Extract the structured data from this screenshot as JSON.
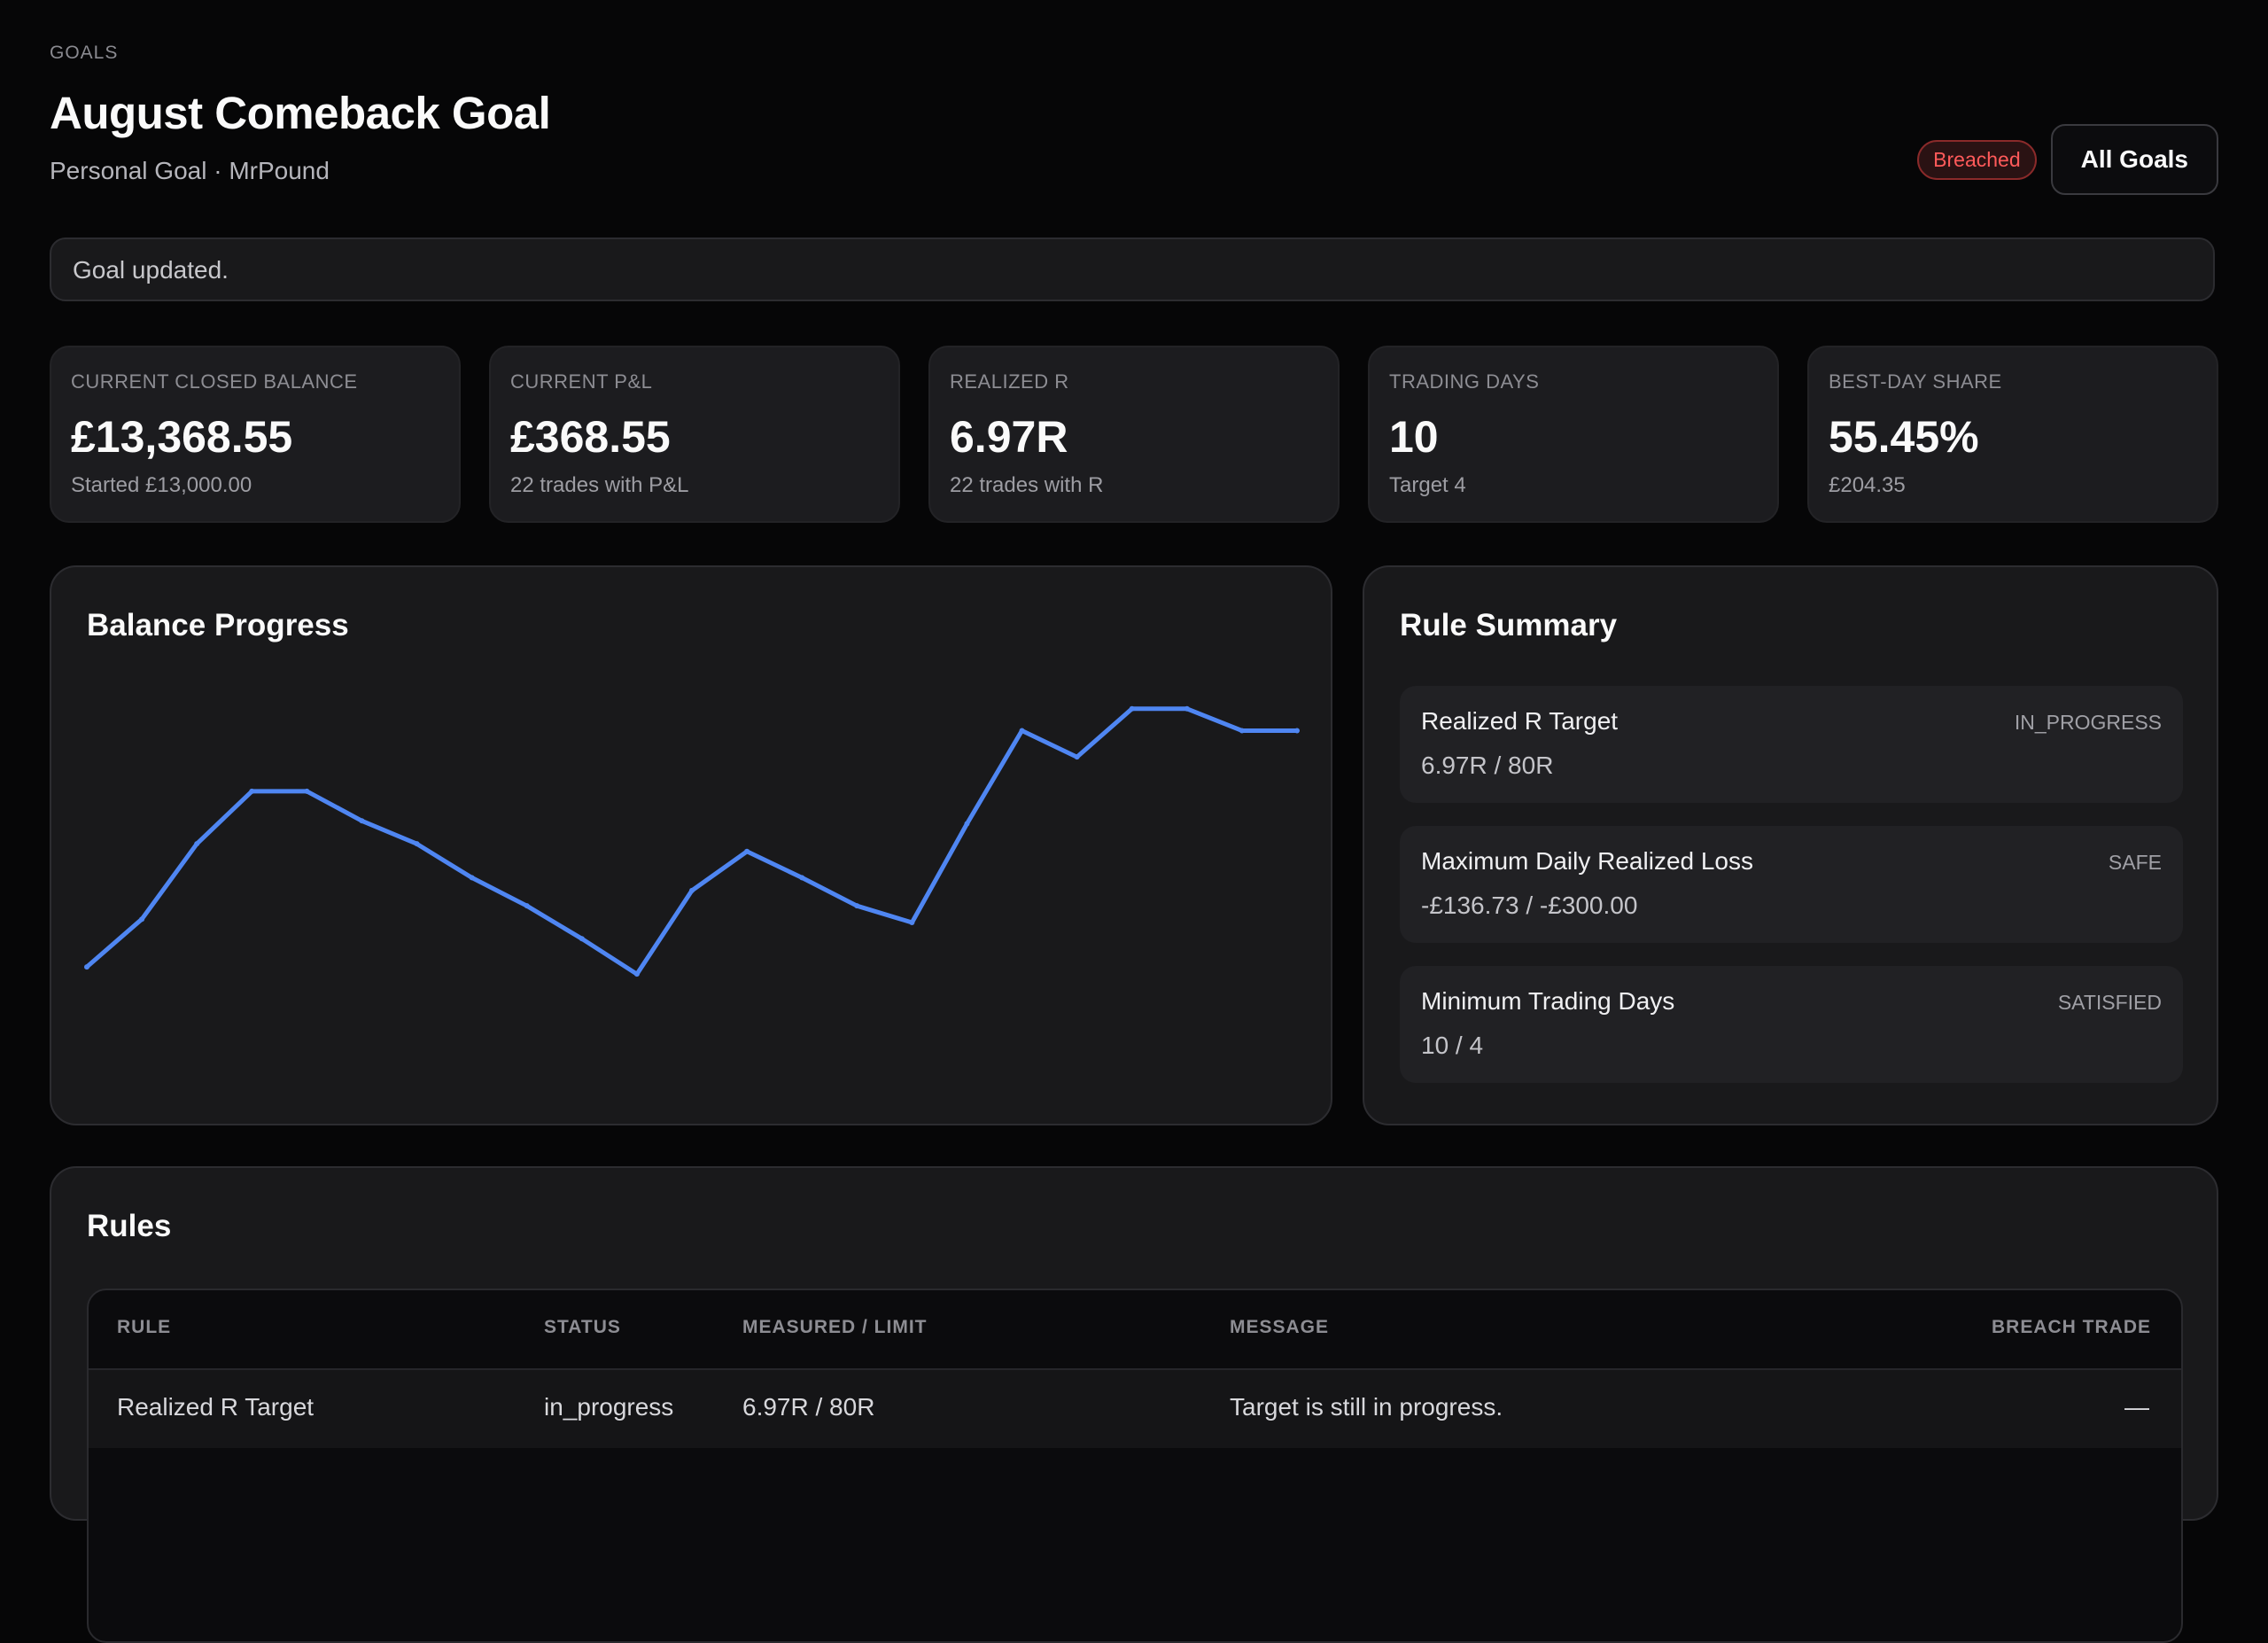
{
  "header": {
    "eyebrow": "GOALS",
    "title": "August Comeback Goal",
    "subtitle": "Personal Goal · MrPound",
    "status_badge": "Breached",
    "all_goals_label": "All Goals"
  },
  "notice": "Goal updated.",
  "stats": [
    {
      "label": "CURRENT CLOSED BALANCE",
      "value": "£13,368.55",
      "sub": "Started £13,000.00"
    },
    {
      "label": "CURRENT P&L",
      "value": "£368.55",
      "sub": "22 trades with P&L"
    },
    {
      "label": "REALIZED R",
      "value": "6.97R",
      "sub": "22 trades with R"
    },
    {
      "label": "TRADING DAYS",
      "value": "10",
      "sub": "Target 4"
    },
    {
      "label": "BEST-DAY SHARE",
      "value": "55.45%",
      "sub": "£204.35"
    }
  ],
  "balance_progress": {
    "title": "Balance Progress",
    "line_color": "#4f86f2"
  },
  "chart_data": {
    "type": "line",
    "title": "Balance Progress",
    "x": [
      1,
      2,
      3,
      4,
      5,
      6,
      7,
      8,
      9,
      10,
      11,
      12,
      13,
      14,
      15,
      16,
      17,
      18,
      19,
      20,
      21,
      22,
      23
    ],
    "values": [
      13000,
      13100,
      13258,
      13368,
      13368,
      13306,
      13258,
      13187,
      13128,
      13059,
      12985,
      13160,
      13242,
      13187,
      13128,
      13093,
      13300,
      13495,
      13440,
      13541,
      13541,
      13495,
      13495
    ],
    "ylim": [
      12950,
      13600
    ],
    "grid": false,
    "series": [
      {
        "values": [
          13000,
          13100,
          13258,
          13368,
          13368,
          13306,
          13258,
          13187,
          13128,
          13059,
          12985,
          13160,
          13242,
          13187,
          13128,
          13093,
          13300,
          13495,
          13440,
          13541,
          13541,
          13495,
          13495
        ]
      }
    ]
  },
  "rule_summary": {
    "title": "Rule Summary",
    "items": [
      {
        "name": "Realized R Target",
        "value": "6.97R / 80R",
        "status": "IN_PROGRESS"
      },
      {
        "name": "Maximum Daily Realized Loss",
        "value": "-£136.73 / -£300.00",
        "status": "SAFE"
      },
      {
        "name": "Minimum Trading Days",
        "value": "10 / 4",
        "status": "SATISFIED"
      }
    ]
  },
  "rules": {
    "title": "Rules",
    "columns": [
      "RULE",
      "STATUS",
      "MEASURED / LIMIT",
      "MESSAGE",
      "BREACH TRADE"
    ],
    "rows": [
      {
        "rule": "Realized R Target",
        "status": "in_progress",
        "measured": "6.97R / 80R",
        "message": "Target is still in progress.",
        "breach_trade": "—"
      }
    ]
  }
}
